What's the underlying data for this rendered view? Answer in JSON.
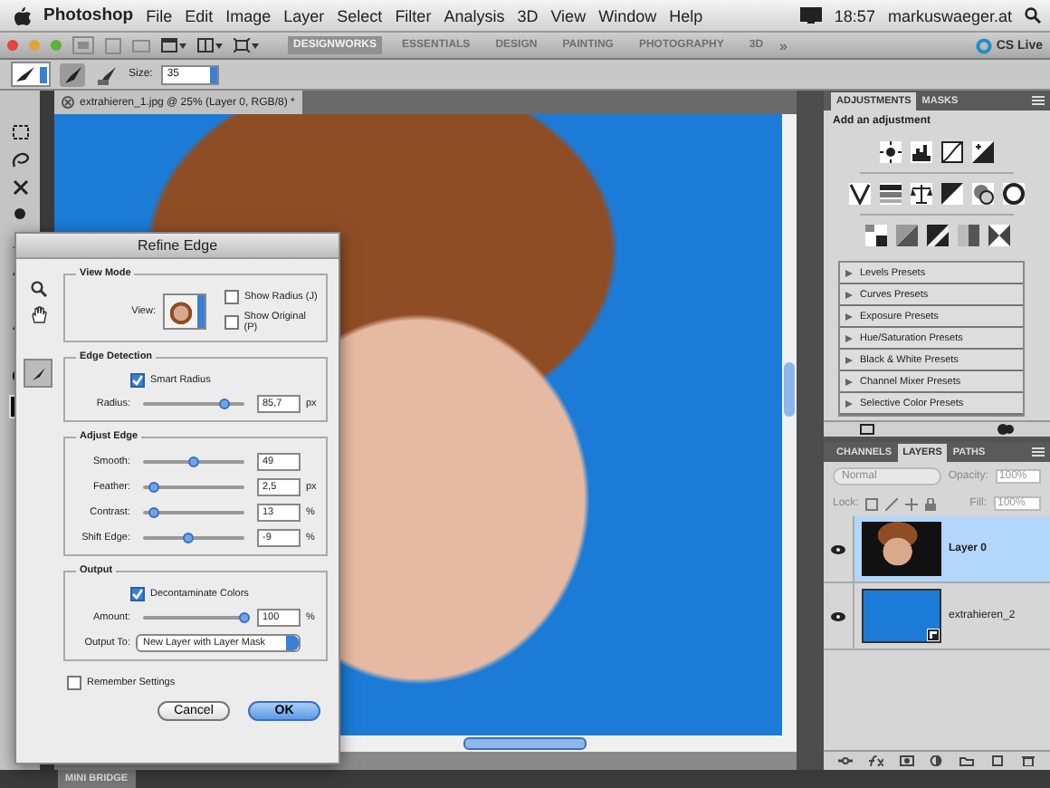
{
  "menubar": {
    "app": "Photoshop",
    "menus": [
      "File",
      "Edit",
      "Image",
      "Layer",
      "Select",
      "Filter",
      "Analysis",
      "3D",
      "View",
      "Window",
      "Help"
    ],
    "time": "18:57",
    "user": "markuswaeger.at"
  },
  "app_bar": {
    "workspaces": [
      {
        "label": "DESIGNWORKS",
        "selected": true
      },
      {
        "label": "ESSENTIALS",
        "selected": false
      },
      {
        "label": "DESIGN",
        "selected": false
      },
      {
        "label": "PAINTING",
        "selected": false
      },
      {
        "label": "PHOTOGRAPHY",
        "selected": false
      },
      {
        "label": "3D",
        "selected": false
      }
    ],
    "more": "»",
    "cs_live": "CS Live"
  },
  "options_bar": {
    "size_label": "Size:",
    "size": "35"
  },
  "document": {
    "tab": "extrahieren_1.jpg @ 25% (Layer 0, RGB/8) *"
  },
  "refine_edge": {
    "title": "Refine Edge",
    "view_mode": {
      "title": "View Mode",
      "view_label": "View:",
      "checkboxes": [
        {
          "label": "Show Radius (J)",
          "checked": false
        },
        {
          "label": "Show Original (P)",
          "checked": false
        }
      ]
    },
    "edge_detection": {
      "title": "Edge Detection",
      "smart_radius": {
        "label": "Smart Radius",
        "checked": true
      },
      "sliders": [
        {
          "label": "Radius:",
          "level": 0.8,
          "value": "85,7",
          "unit": "px"
        }
      ]
    },
    "adjust_edge": {
      "title": "Adjust Edge",
      "sliders": [
        {
          "label": "Smooth:",
          "level": 0.5,
          "value": "49"
        },
        {
          "label": "Feather:",
          "level": 0.1,
          "value": "2,5",
          "unit": "px"
        },
        {
          "label": "Contrast:",
          "level": 0.1,
          "value": "13",
          "unit": "%"
        },
        {
          "label": "Shift Edge:",
          "level": 0.45,
          "value": "-9",
          "unit": "%"
        }
      ]
    },
    "output": {
      "title": "Output",
      "decontaminate": {
        "label": "Decontaminate Colors",
        "checked": true
      },
      "sliders": [
        {
          "label": "Amount:",
          "level": 1.0,
          "value": "100",
          "unit": "%"
        }
      ],
      "output_to_label": "Output To:",
      "output_to": "New Layer with Layer Mask"
    },
    "remember": {
      "label": "Remember Settings",
      "checked": false
    },
    "buttons": [
      {
        "label": "Cancel",
        "kind": "secondary"
      },
      {
        "label": "OK",
        "kind": "default"
      }
    ]
  },
  "adjustments": {
    "tabs": [
      {
        "label": "ADJUSTMENTS",
        "selected": true
      },
      {
        "label": "MASKS",
        "selected": false
      }
    ],
    "heading": "Add an adjustment",
    "presets": [
      "Levels Presets",
      "Curves Presets",
      "Exposure Presets",
      "Hue/Saturation Presets",
      "Black & White Presets",
      "Channel Mixer Presets",
      "Selective Color Presets"
    ]
  },
  "layers_panel": {
    "tabs": [
      {
        "label": "CHANNELS",
        "selected": false
      },
      {
        "label": "LAYERS",
        "selected": true
      },
      {
        "label": "PATHS",
        "selected": false
      }
    ],
    "blend_mode": "Normal",
    "opacity_label": "Opacity:",
    "opacity": "100%",
    "lock_label": "Lock:",
    "fill_label": "Fill:",
    "fill": "100%",
    "layers": [
      {
        "name": "Layer 0",
        "selected": true,
        "visible": true,
        "kind": "pixel"
      },
      {
        "name": "extrahieren_2",
        "selected": false,
        "visible": true,
        "kind": "smart_object"
      }
    ]
  },
  "mini_bridge": "MINI BRIDGE"
}
